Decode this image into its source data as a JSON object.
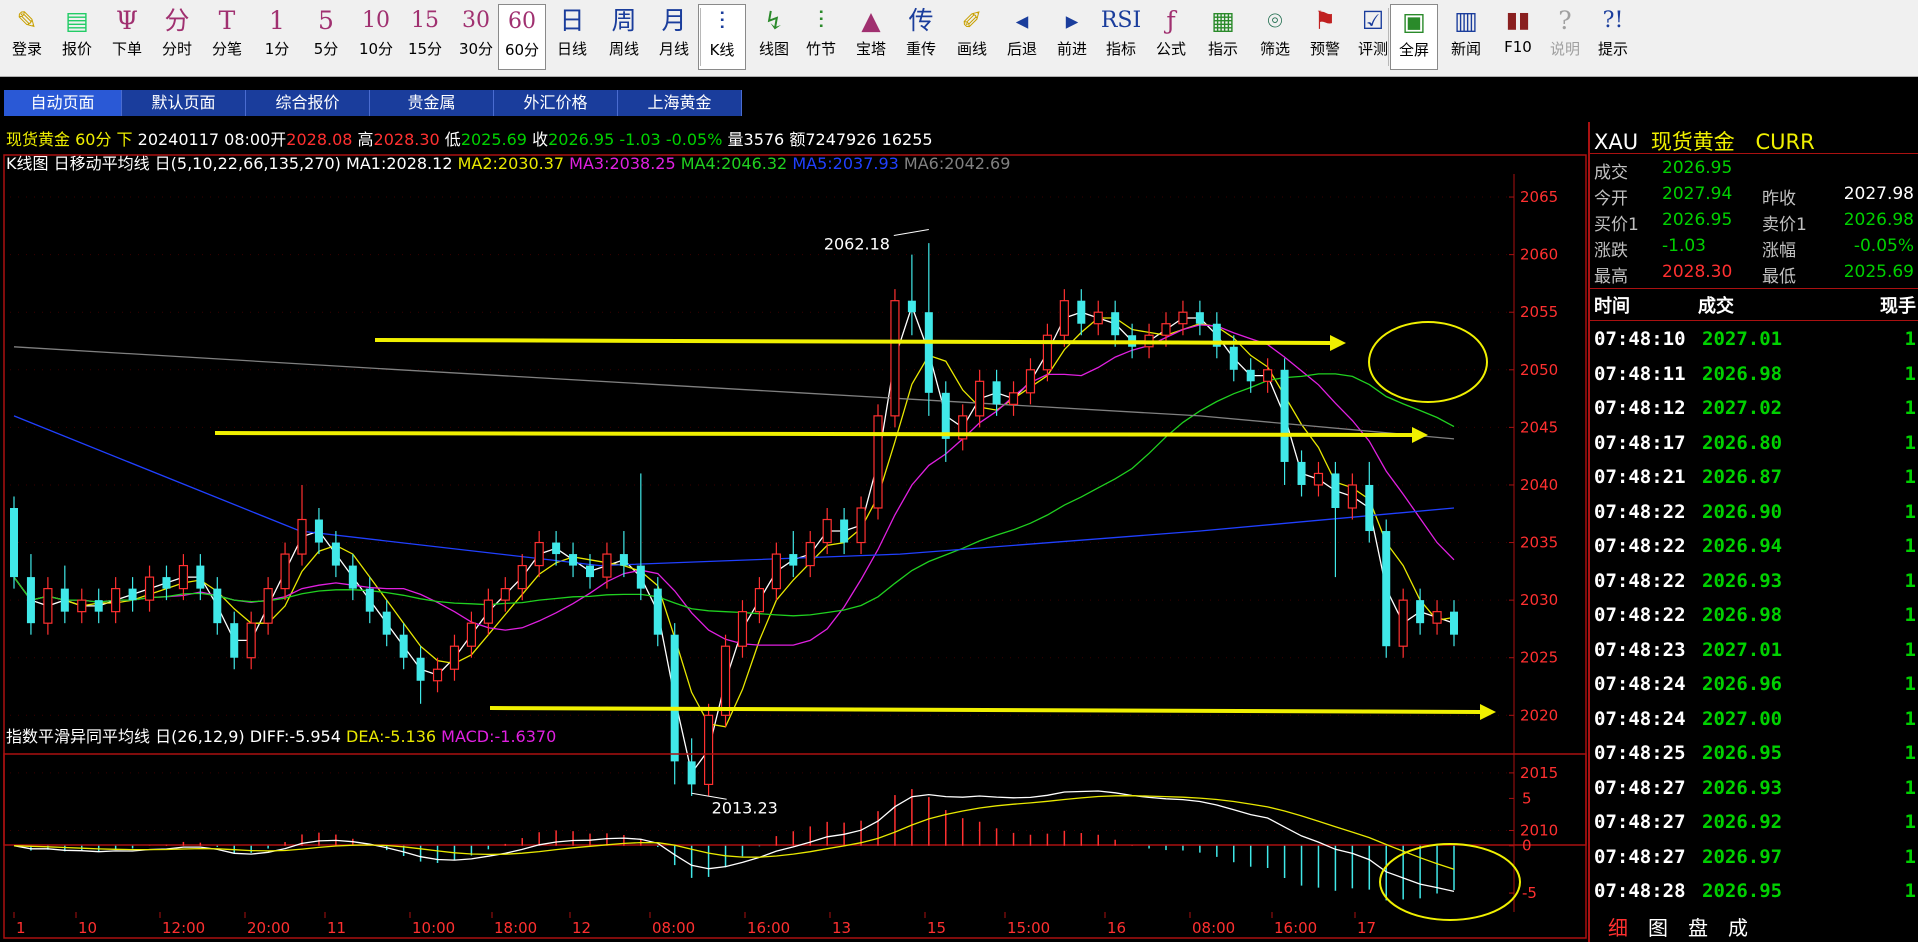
{
  "toolbar": [
    {
      "icon": "✎",
      "label": "登录",
      "name": "login",
      "color": "#c8a000"
    },
    {
      "icon": "▤",
      "label": "报价",
      "name": "quote",
      "color": "#2c6"
    },
    {
      "icon": "Ψ",
      "label": "下单",
      "name": "order",
      "color": "#a03070"
    },
    {
      "icon": "分",
      "label": "分时",
      "name": "minute",
      "color": "#a03070"
    },
    {
      "icon": "T",
      "label": "分笔",
      "name": "tick",
      "color": "#a03070"
    },
    {
      "icon": "1",
      "label": "1分",
      "name": "1min",
      "color": "#a03070"
    },
    {
      "icon": "5",
      "label": "5分",
      "name": "5min",
      "color": "#a03070"
    },
    {
      "icon": "10",
      "label": "10分",
      "name": "10min",
      "color": "#a03070"
    },
    {
      "icon": "15",
      "label": "15分",
      "name": "15min",
      "color": "#a03070"
    },
    {
      "icon": "30",
      "label": "30分",
      "name": "30min",
      "color": "#a03070"
    },
    {
      "icon": "60",
      "label": "60分",
      "name": "60min",
      "color": "#a03070",
      "active": true
    },
    {
      "icon": "日",
      "label": "日线",
      "name": "daily",
      "color": "#1a3d9c"
    },
    {
      "icon": "周",
      "label": "周线",
      "name": "weekly",
      "color": "#1a3d9c"
    },
    {
      "icon": "月",
      "label": "月线",
      "name": "monthly",
      "color": "#1a3d9c"
    },
    {
      "icon": "⫶",
      "label": "K线",
      "name": "kline",
      "color": "#1a3d9c",
      "active": true
    },
    {
      "icon": "↯",
      "label": "线图",
      "name": "linechart",
      "color": "#2a8a2a"
    },
    {
      "icon": "⫶",
      "label": "竹节",
      "name": "bamboo",
      "color": "#2a8a2a"
    },
    {
      "icon": "▲",
      "label": "宝塔",
      "name": "tower",
      "color": "#a03070"
    },
    {
      "icon": "传",
      "label": "重传",
      "name": "reload",
      "color": "#1a3d9c"
    },
    {
      "icon": "✐",
      "label": "画线",
      "name": "draw",
      "color": "#c8a000"
    },
    {
      "icon": "◂",
      "label": "后退",
      "name": "back",
      "color": "#1a3d9c"
    },
    {
      "icon": "▸",
      "label": "前进",
      "name": "forward",
      "color": "#1a3d9c"
    },
    {
      "icon": "RSI",
      "label": "指标",
      "name": "indicator",
      "color": "#1a3d9c"
    },
    {
      "icon": "ƒ",
      "label": "公式",
      "name": "formula",
      "color": "#a03070"
    },
    {
      "icon": "▦",
      "label": "指示",
      "name": "indicate",
      "color": "#2a8a2a"
    },
    {
      "icon": "⌾",
      "label": "筛选",
      "name": "filter",
      "color": "#1a6a4a"
    },
    {
      "icon": "⚑",
      "label": "预警",
      "name": "alert",
      "color": "#c02020"
    },
    {
      "icon": "☑",
      "label": "评测",
      "name": "evaluate",
      "color": "#1a3d9c"
    },
    {
      "icon": "▣",
      "label": "全屏",
      "name": "fullscreen",
      "color": "#2a8a2a",
      "active": true
    },
    {
      "icon": "▥",
      "label": "新闻",
      "name": "news",
      "color": "#1a3d9c"
    },
    {
      "icon": "▮▮",
      "label": "F10",
      "name": "f10",
      "color": "#8a2020"
    },
    {
      "icon": "?",
      "label": "说明",
      "name": "help",
      "color": "#a0a0a0",
      "dim": true
    },
    {
      "icon": "?!",
      "label": "提示",
      "name": "tips",
      "color": "#1a3d9c"
    }
  ],
  "tabs": [
    "自动页面",
    "默认页面",
    "综合报价",
    "贵金属",
    "外汇价格",
    "上海黄金"
  ],
  "header": {
    "name": "现货黄金 60分 下",
    "date": "20240117 08:00",
    "open_label": "开",
    "open": "2028.08",
    "high_label": "高",
    "high": "2028.30",
    "low_label": "低",
    "low": "2025.69",
    "close_label": "收",
    "close": "2026.95",
    "change": "-1.03",
    "change_pct": "-0.05%",
    "vol_label": "量",
    "vol": "3576",
    "amt_label": "额",
    "amt": "7247926 16255"
  },
  "ma_line": {
    "title": "K线图 日移动平均线 日(5,10,22,66,135,270)",
    "items": [
      {
        "text": "MA1:2028.12",
        "color": "#ffffff"
      },
      {
        "text": "MA2:2030.37",
        "color": "#e8e800"
      },
      {
        "text": "MA3:2038.25",
        "color": "#e020e0"
      },
      {
        "text": "MA4:2046.32",
        "color": "#20d020"
      },
      {
        "text": "MA5:2037.93",
        "color": "#2040ff"
      },
      {
        "text": "MA6:2042.69",
        "color": "#808080"
      }
    ]
  },
  "macd_line": {
    "title": "指数平滑异同平均线 日(26,12,9)",
    "items": [
      {
        "text": "DIFF:-5.954",
        "color": "#ffffff"
      },
      {
        "text": "DEA:-5.136",
        "color": "#e8e800"
      },
      {
        "text": "MACD:-1.6370",
        "color": "#e020e0"
      }
    ]
  },
  "chart_data": {
    "type": "candlestick",
    "main_axis": {
      "ticks": [
        2065,
        2060,
        2055,
        2050,
        2045,
        2040,
        2035,
        2030,
        2025,
        2020,
        2015,
        2010
      ],
      "min": 2009,
      "max": 2067
    },
    "macd_axis": {
      "ticks": [
        5,
        0,
        -5
      ],
      "min": -7,
      "max": 8
    },
    "x_labels": [
      "1",
      "10",
      "12:00",
      "20:00",
      "11",
      "10:00",
      "18:00",
      "12",
      "08:00",
      "16:00",
      "13",
      "15",
      "15:00",
      "16",
      "08:00",
      "16:00",
      "17"
    ],
    "annotations": [
      {
        "text": "2062.18",
        "value": 2062.18
      },
      {
        "text": "2013.23",
        "value": 2013.23
      }
    ],
    "candles": [
      [
        2038,
        2032,
        2039,
        2031
      ],
      [
        2032,
        2028,
        2034,
        2027
      ],
      [
        2028,
        2031,
        2032,
        2027
      ],
      [
        2031,
        2029,
        2033,
        2028
      ],
      [
        2029,
        2030,
        2031,
        2028
      ],
      [
        2030,
        2029,
        2031,
        2028
      ],
      [
        2029,
        2031,
        2032,
        2028
      ],
      [
        2031,
        2030,
        2032,
        2029
      ],
      [
        2030,
        2032,
        2033,
        2029
      ],
      [
        2032,
        2031,
        2033,
        2030
      ],
      [
        2031,
        2033,
        2034,
        2030
      ],
      [
        2033,
        2031,
        2034,
        2030
      ],
      [
        2031,
        2028,
        2032,
        2027
      ],
      [
        2028,
        2025,
        2029,
        2024
      ],
      [
        2025,
        2028,
        2029,
        2024
      ],
      [
        2028,
        2031,
        2032,
        2027
      ],
      [
        2031,
        2034,
        2035,
        2030
      ],
      [
        2034,
        2037,
        2040,
        2033
      ],
      [
        2037,
        2035,
        2038,
        2034
      ],
      [
        2035,
        2033,
        2036,
        2032
      ],
      [
        2033,
        2031,
        2034,
        2030
      ],
      [
        2031,
        2029,
        2032,
        2028
      ],
      [
        2029,
        2027,
        2030,
        2026
      ],
      [
        2027,
        2025,
        2028,
        2024
      ],
      [
        2025,
        2023,
        2026,
        2021
      ],
      [
        2023,
        2024,
        2025,
        2022
      ],
      [
        2024,
        2026,
        2027,
        2023
      ],
      [
        2026,
        2028,
        2029,
        2025
      ],
      [
        2028,
        2030,
        2031,
        2027
      ],
      [
        2030,
        2031,
        2032,
        2029
      ],
      [
        2031,
        2033,
        2034,
        2030
      ],
      [
        2033,
        2035,
        2036,
        2032
      ],
      [
        2035,
        2034,
        2036,
        2033
      ],
      [
        2034,
        2033,
        2035,
        2032
      ],
      [
        2033,
        2032,
        2034,
        2031
      ],
      [
        2032,
        2034,
        2035,
        2031
      ],
      [
        2034,
        2033,
        2036,
        2032
      ],
      [
        2033,
        2031,
        2041,
        2030
      ],
      [
        2031,
        2027,
        2032,
        2026
      ],
      [
        2027,
        2016,
        2028,
        2014
      ],
      [
        2016,
        2014,
        2018,
        2013
      ],
      [
        2014,
        2020,
        2021,
        2013
      ],
      [
        2020,
        2026,
        2027,
        2019
      ],
      [
        2026,
        2029,
        2030,
        2025
      ],
      [
        2029,
        2031,
        2032,
        2028
      ],
      [
        2031,
        2034,
        2035,
        2030
      ],
      [
        2034,
        2033,
        2036,
        2032
      ],
      [
        2033,
        2035,
        2036,
        2032
      ],
      [
        2035,
        2037,
        2038,
        2034
      ],
      [
        2037,
        2035,
        2038,
        2034
      ],
      [
        2035,
        2038,
        2039,
        2034
      ],
      [
        2038,
        2046,
        2047,
        2037
      ],
      [
        2046,
        2056,
        2057,
        2045
      ],
      [
        2056,
        2055,
        2060,
        2053
      ],
      [
        2055,
        2048,
        2061,
        2046
      ],
      [
        2048,
        2044,
        2049,
        2042
      ],
      [
        2044,
        2046,
        2047,
        2043
      ],
      [
        2046,
        2049,
        2050,
        2045
      ],
      [
        2049,
        2047,
        2050,
        2046
      ],
      [
        2047,
        2048,
        2049,
        2046
      ],
      [
        2048,
        2050,
        2051,
        2047
      ],
      [
        2050,
        2053,
        2054,
        2049
      ],
      [
        2053,
        2056,
        2057,
        2052
      ],
      [
        2056,
        2054,
        2057,
        2053
      ],
      [
        2054,
        2055,
        2056,
        2053
      ],
      [
        2055,
        2053,
        2056,
        2052
      ],
      [
        2053,
        2052,
        2054,
        2051
      ],
      [
        2052,
        2053,
        2054,
        2051
      ],
      [
        2053,
        2054,
        2055,
        2052
      ],
      [
        2054,
        2055,
        2056,
        2053
      ],
      [
        2055,
        2054,
        2056,
        2053
      ],
      [
        2054,
        2052,
        2055,
        2051
      ],
      [
        2052,
        2050,
        2053,
        2049
      ],
      [
        2050,
        2049,
        2051,
        2048
      ],
      [
        2049,
        2050,
        2051,
        2048
      ],
      [
        2050,
        2042,
        2051,
        2040
      ],
      [
        2042,
        2040,
        2043,
        2039
      ],
      [
        2040,
        2041,
        2042,
        2039
      ],
      [
        2041,
        2038,
        2042,
        2032
      ],
      [
        2038,
        2040,
        2041,
        2037
      ],
      [
        2040,
        2036,
        2042,
        2035
      ],
      [
        2036,
        2026,
        2037,
        2025
      ],
      [
        2026,
        2030,
        2031,
        2025
      ],
      [
        2030,
        2028,
        2031,
        2027
      ],
      [
        2028,
        2029,
        2030,
        2027
      ],
      [
        2029,
        2027,
        2030,
        2026
      ]
    ]
  },
  "quote": {
    "title_code": "XAU",
    "title_name": "现货黄金",
    "title_suffix": "CURR",
    "rows": [
      {
        "l1": "成交",
        "v1": "2026.95",
        "c1": "green"
      },
      {
        "l1": "今开",
        "v1": "2027.94",
        "c1": "green",
        "l2": "昨收",
        "v2": "2027.98",
        "c2": "wht"
      },
      {
        "l1": "买价1",
        "v1": "2026.95",
        "c1": "green",
        "l2": "卖价1",
        "v2": "2026.98",
        "c2": "green"
      },
      {
        "l1": "涨跌",
        "v1": "-1.03",
        "c1": "green",
        "l2": "涨幅",
        "v2": "-0.05%",
        "c2": "green"
      },
      {
        "l1": "最高",
        "v1": "2028.30",
        "c1": "red",
        "l2": "最低",
        "v2": "2025.69",
        "c2": "green"
      }
    ],
    "tick_header": {
      "time": "时间",
      "price": "成交",
      "vol": "现手"
    },
    "ticks": [
      {
        "t": "07:48:10",
        "p": "2027.01",
        "v": "1"
      },
      {
        "t": "07:48:11",
        "p": "2026.98",
        "v": "1"
      },
      {
        "t": "07:48:12",
        "p": "2027.02",
        "v": "1"
      },
      {
        "t": "07:48:17",
        "p": "2026.80",
        "v": "1"
      },
      {
        "t": "07:48:21",
        "p": "2026.87",
        "v": "1"
      },
      {
        "t": "07:48:22",
        "p": "2026.90",
        "v": "1"
      },
      {
        "t": "07:48:22",
        "p": "2026.94",
        "v": "1"
      },
      {
        "t": "07:48:22",
        "p": "2026.93",
        "v": "1"
      },
      {
        "t": "07:48:22",
        "p": "2026.98",
        "v": "1"
      },
      {
        "t": "07:48:23",
        "p": "2027.01",
        "v": "1"
      },
      {
        "t": "07:48:24",
        "p": "2026.96",
        "v": "1"
      },
      {
        "t": "07:48:24",
        "p": "2027.00",
        "v": "1"
      },
      {
        "t": "07:48:25",
        "p": "2026.95",
        "v": "1"
      },
      {
        "t": "07:48:27",
        "p": "2026.93",
        "v": "1"
      },
      {
        "t": "07:48:27",
        "p": "2026.92",
        "v": "1"
      },
      {
        "t": "07:48:27",
        "p": "2026.97",
        "v": "1"
      },
      {
        "t": "07:48:28",
        "p": "2026.95",
        "v": "1"
      }
    ],
    "bottom_tabs": [
      "细",
      "图",
      "盘",
      "成"
    ]
  }
}
